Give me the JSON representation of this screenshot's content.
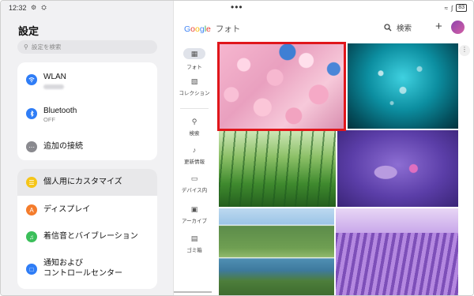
{
  "status_bar": {
    "time": "12:32",
    "battery": "83"
  },
  "settings": {
    "title": "設定",
    "search_placeholder": "設定を検索",
    "group1": [
      {
        "label": "WLAN",
        "sub": "",
        "icon": "wifi-icon",
        "color": "#2f7df6"
      },
      {
        "label": "Bluetooth",
        "sub": "OFF",
        "icon": "bluetooth-icon",
        "color": "#2f7df6"
      },
      {
        "label": "追加の接続",
        "sub": "",
        "icon": "more-connections-icon",
        "color": "#8a8a8f"
      }
    ],
    "group2": [
      {
        "label": "個人用にカスタマイズ",
        "icon": "customize-icon",
        "color": "#f5c518",
        "selected": true
      },
      {
        "label": "ディスプレイ",
        "icon": "display-icon",
        "color": "#f47c2c"
      },
      {
        "label": "着信音とバイブレーション",
        "icon": "sound-icon",
        "color": "#3bbf5a"
      },
      {
        "label": "通知および",
        "label2": "コントロールセンター",
        "icon": "notification-icon",
        "color": "#2f7df6"
      }
    ]
  },
  "photos_app": {
    "logo_letters": [
      "G",
      "o",
      "o",
      "g",
      "l",
      "e"
    ],
    "logo_suffix": "フォト",
    "search_label": "検索",
    "avatar_text": "■",
    "nav": [
      {
        "label": "フォト",
        "icon": "photo-icon",
        "active": true
      },
      {
        "label": "コレクション",
        "icon": "collection-icon"
      },
      {
        "label": "検索",
        "icon": "search-icon"
      },
      {
        "label": "更新情報",
        "icon": "bell-icon"
      },
      {
        "label": "デバイス内",
        "icon": "folder-icon"
      },
      {
        "label": "アーカイブ",
        "icon": "archive-icon"
      },
      {
        "label": "ゴミ箱",
        "icon": "trash-icon"
      }
    ],
    "photos": [
      {
        "name": "cherry-blossom-photo",
        "selected": true
      },
      {
        "name": "underwater-bubbles-photo"
      },
      {
        "name": "grass-dew-photo"
      },
      {
        "name": "water-lily-photo"
      },
      {
        "name": "mountain-lake-photo"
      },
      {
        "name": "lavender-field-photo"
      }
    ],
    "highlight_color": "#e0161b"
  }
}
